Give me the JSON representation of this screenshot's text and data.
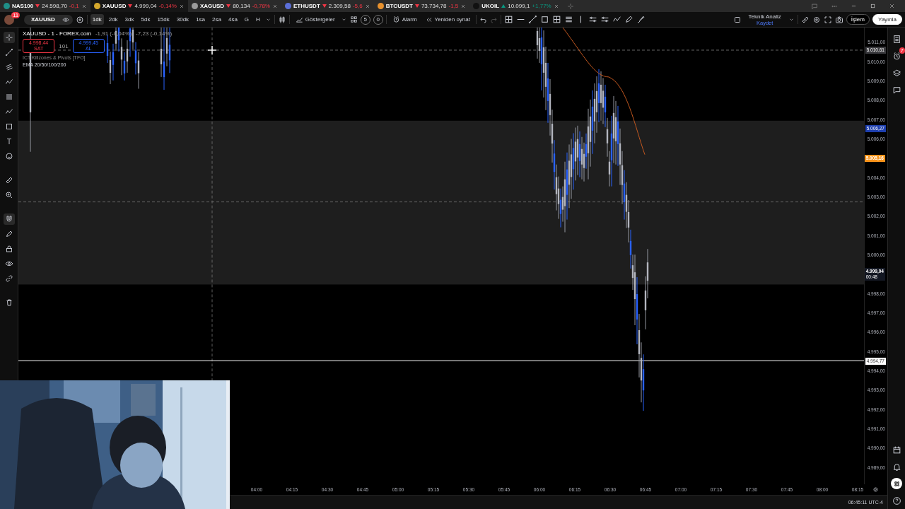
{
  "tabs": [
    {
      "symbol": "NAS100",
      "price": "24.598,70",
      "change": "-0,1",
      "kind": "down",
      "color": "#1f8f88",
      "selected": false
    },
    {
      "symbol": "XAUUSD",
      "price": "4.999,04",
      "change": "-0,14%",
      "kind": "down",
      "color": "#d4a72c",
      "selected": true
    },
    {
      "symbol": "XAGUSD",
      "price": "80,134",
      "change": "-0,78%",
      "kind": "down",
      "color": "#9a9a9a",
      "selected": false
    },
    {
      "symbol": "ETHUSDT",
      "price": "2.309,58",
      "change": "-5,6",
      "kind": "down",
      "color": "#5b6fd8",
      "selected": false
    },
    {
      "symbol": "BTCUSDT",
      "price": "73.734,78",
      "change": "-1,5",
      "kind": "down",
      "color": "#e8912d",
      "selected": false
    },
    {
      "symbol": "UKOIL",
      "price": "10.099,1",
      "change": "+1,77%",
      "kind": "up",
      "color": "#111111",
      "selected": false
    }
  ],
  "toolbar": {
    "avatar_badge": "11",
    "symbol": "XAUUSD",
    "intervals": [
      {
        "label": "1dk",
        "selected": true
      },
      {
        "label": "2dk",
        "selected": false
      },
      {
        "label": "3dk",
        "selected": false
      },
      {
        "label": "5dk",
        "selected": false
      },
      {
        "label": "15dk",
        "selected": false
      },
      {
        "label": "30dk",
        "selected": false
      },
      {
        "label": "1sa",
        "selected": false
      },
      {
        "label": "2sa",
        "selected": false
      },
      {
        "label": "4sa",
        "selected": false
      },
      {
        "label": "G",
        "selected": false
      },
      {
        "label": "H",
        "selected": false
      }
    ],
    "indicators": "Göstergeler",
    "counts": [
      "5",
      "0"
    ],
    "alarm": "Alarm",
    "replay": "Yeniden oynat",
    "layout": {
      "name": "Teknik Analiz",
      "status": "Kaydet"
    },
    "trade": "İşlem",
    "publish": "Yayınla"
  },
  "legend": {
    "title": "XAUUSD - 1 - FOREX.com",
    "change": "-1,91 (-0,04%)",
    "change2": "-7,23 (-0,14%)",
    "sell": {
      "price": "4.998,44",
      "label": "SAT"
    },
    "spread": "101",
    "buy": {
      "price": "4.999,45",
      "label": "AL"
    },
    "indicators": [
      "ICT Killzones & Pivots [TFO]",
      "EMA 20/50/100/200"
    ]
  },
  "price_axis": {
    "labels": [
      {
        "text": "5.011,00",
        "kind": "tick"
      },
      {
        "text": "5.010,00",
        "kind": "tick"
      },
      {
        "text": "5.009,00",
        "kind": "tick"
      },
      {
        "text": "5.008,00",
        "kind": "tick"
      },
      {
        "text": "5.007,00",
        "kind": "tick"
      },
      {
        "text": "5.006,00",
        "kind": "tick"
      },
      {
        "text": "5.005,16",
        "kind": "badge",
        "color": "#f7931a"
      },
      {
        "text": "5.004,00",
        "kind": "tick"
      },
      {
        "text": "5.003,00",
        "kind": "tick"
      },
      {
        "text": "5.002,00",
        "kind": "tick"
      },
      {
        "text": "5.001,00",
        "kind": "tick"
      },
      {
        "text": "5.000,00",
        "kind": "tick"
      },
      {
        "text": "4.999,04",
        "sub": "00:48",
        "kind": "badge",
        "color": "#131722"
      },
      {
        "text": "4.998,00",
        "kind": "tick"
      },
      {
        "text": "4.997,00",
        "kind": "tick"
      },
      {
        "text": "4.996,00",
        "kind": "tick"
      },
      {
        "text": "4.995,00",
        "kind": "tick"
      },
      {
        "text": "4.994,00",
        "kind": "tick"
      },
      {
        "text": "4.993,00",
        "kind": "tick"
      },
      {
        "text": "4.992,00",
        "kind": "tick"
      },
      {
        "text": "4.991,00",
        "kind": "tick"
      },
      {
        "text": "4.990,00",
        "kind": "tick"
      },
      {
        "text": "4.989,00",
        "kind": "tick"
      }
    ],
    "markers": [
      {
        "text": "5.010,61",
        "color": "#3a3a3e"
      },
      {
        "text": "5.006,27",
        "color": "#1e3fae"
      },
      {
        "text": "4.994,77",
        "color": "#ffffff"
      }
    ]
  },
  "time_axis": {
    "labels": [
      "04:00",
      "04:15",
      "04:30",
      "04:45",
      "05:00",
      "05:15",
      "05:30",
      "05:45",
      "06:00",
      "06:15",
      "06:30",
      "06:45",
      "07:00",
      "07:15",
      "07:30",
      "07:45",
      "08:00",
      "08:15"
    ]
  },
  "status": {
    "clock": "06:45:11 UTC-4"
  },
  "sidebar": {
    "alert_badge": "7"
  }
}
